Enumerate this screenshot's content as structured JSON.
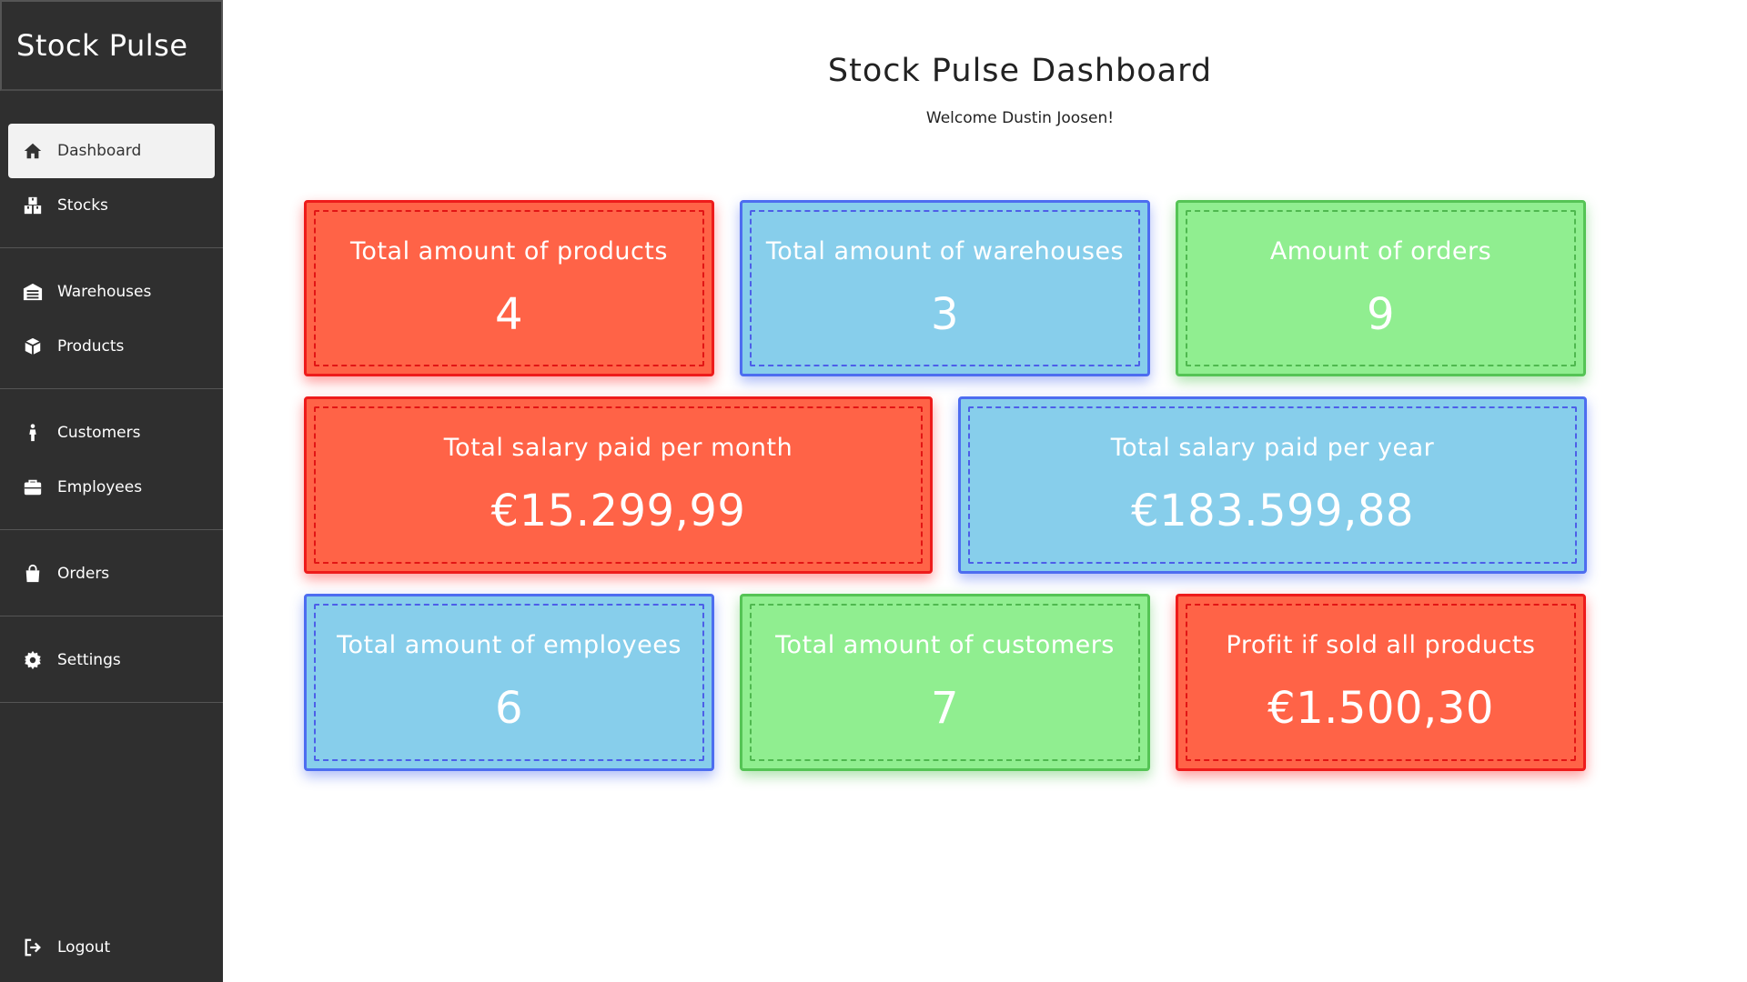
{
  "app": {
    "brand": "Stock Pulse"
  },
  "sidebar": {
    "groups": [
      [
        {
          "label": "Dashboard",
          "icon": "home-icon",
          "active": true
        },
        {
          "label": "Stocks",
          "icon": "boxes-icon"
        }
      ],
      [
        {
          "label": "Warehouses",
          "icon": "warehouse-icon"
        },
        {
          "label": "Products",
          "icon": "cube-icon"
        }
      ],
      [
        {
          "label": "Customers",
          "icon": "person-icon"
        },
        {
          "label": "Employees",
          "icon": "briefcase-icon"
        }
      ],
      [
        {
          "label": "Orders",
          "icon": "shopping-bag-icon"
        }
      ],
      [
        {
          "label": "Settings",
          "icon": "gear-icon"
        }
      ]
    ],
    "logout": {
      "label": "Logout",
      "icon": "logout-icon"
    }
  },
  "header": {
    "title": "Stock Pulse Dashboard",
    "welcome": "Welcome Dustin Joosen!"
  },
  "cards": {
    "products": {
      "label": "Total amount of products",
      "value": "4",
      "color": "#ff6347"
    },
    "warehouses": {
      "label": "Total amount of warehouses",
      "value": "3",
      "color": "#87ceeb"
    },
    "orders": {
      "label": "Amount of orders",
      "value": "9",
      "color": "#90ee90"
    },
    "salary_month": {
      "label": "Total salary paid per month",
      "value": "€15.299,99",
      "color": "#ff6347"
    },
    "salary_year": {
      "label": "Total salary paid per year",
      "value": "€183.599,88",
      "color": "#87ceeb"
    },
    "employees": {
      "label": "Total amount of employees",
      "value": "6",
      "color": "#87ceeb"
    },
    "customers": {
      "label": "Total amount of customers",
      "value": "7",
      "color": "#90ee90"
    },
    "profit": {
      "label": "Profit if sold all products",
      "value": "€1.500,30",
      "color": "#ff6347"
    }
  }
}
